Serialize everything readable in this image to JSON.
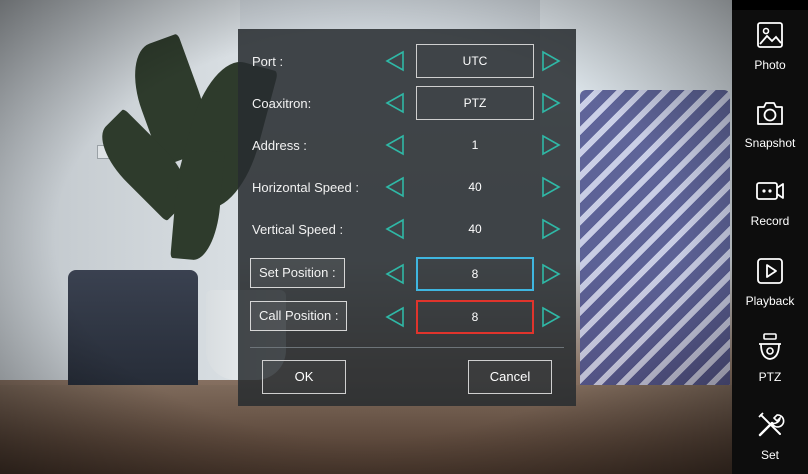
{
  "dialog": {
    "rows": [
      {
        "label": "Port :",
        "value": "UTC"
      },
      {
        "label": "Coaxitron:",
        "value": "PTZ"
      },
      {
        "label": "Address :",
        "value": "1"
      },
      {
        "label": "Horizontal Speed :",
        "value": "40"
      },
      {
        "label": "Vertical Speed :",
        "value": "40"
      },
      {
        "label": "Set Position :",
        "value": "8"
      },
      {
        "label": "Call Position :",
        "value": "8"
      }
    ],
    "ok_label": "OK",
    "cancel_label": "Cancel"
  },
  "sidebar": {
    "items": [
      {
        "label": "Photo",
        "icon": "photo-icon"
      },
      {
        "label": "Snapshot",
        "icon": "camera-icon"
      },
      {
        "label": "Record",
        "icon": "record-icon"
      },
      {
        "label": "Playback",
        "icon": "playback-icon"
      },
      {
        "label": "PTZ",
        "icon": "ptz-dome-camera-icon"
      },
      {
        "label": "Set",
        "icon": "tools-icon"
      }
    ]
  },
  "colors": {
    "arrow": "#2fb8a6",
    "selected_border": "#3fb6e0",
    "active_border": "#e0342c"
  }
}
